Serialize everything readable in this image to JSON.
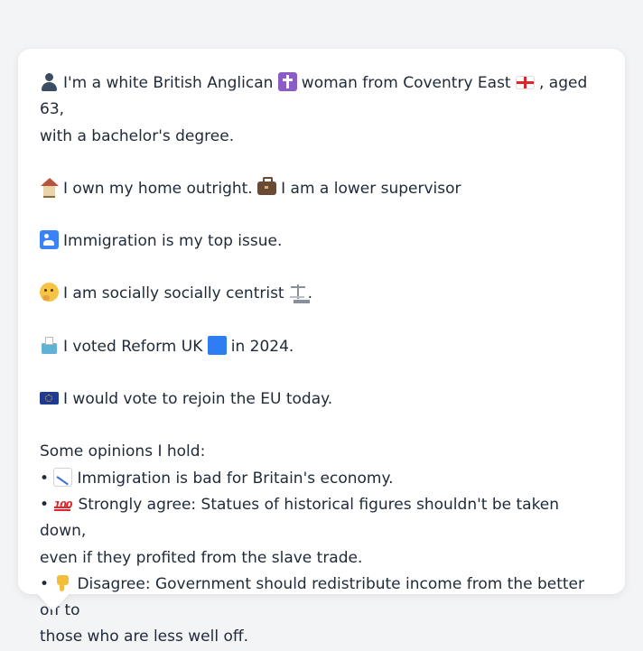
{
  "profile": {
    "intro": {
      "icon": "person-silhouette-icon",
      "part1": "I'm a white British Anglican",
      "religion_icon": "purple-cross-icon",
      "part2": "woman from Coventry East",
      "flag_icon": "england-flag-icon",
      "part3": ", aged 63,",
      "part4": "with a bachelor's degree."
    },
    "home": {
      "icon": "house-icon",
      "text1": "I own my home outright.",
      "job_icon": "briefcase-icon",
      "text2": "I am a lower supervisor"
    },
    "issue": {
      "icon": "immigration-icon",
      "text": "Immigration is my top issue."
    },
    "social": {
      "icon": "thinking-face-icon",
      "text": "I am socially socially centrist",
      "after_icon": "scales-icon",
      "suffix": "."
    },
    "vote": {
      "icon": "ballot-box-icon",
      "text1": "I voted Reform UK",
      "party_icon": "blue-square-icon",
      "text2": "in 2024."
    },
    "eu": {
      "icon": "eu-flag-icon",
      "text": "I would vote to rejoin the EU today."
    },
    "opinions": {
      "heading": "Some opinions I hold:",
      "bullet": "•",
      "items": [
        {
          "icon": "chart-decreasing-icon",
          "line1": "Immigration is bad for Britain's economy.",
          "line2": ""
        },
        {
          "icon": "hundred-points-icon",
          "line1": "Strongly agree: Statues of historical figures shouldn't be taken down,",
          "line2": "even if they profited from the slave trade."
        },
        {
          "icon": "thumbs-down-icon",
          "line1": "Disagree: Government should redistribute income from the better off to",
          "line2": "those who are less well off."
        }
      ]
    }
  }
}
